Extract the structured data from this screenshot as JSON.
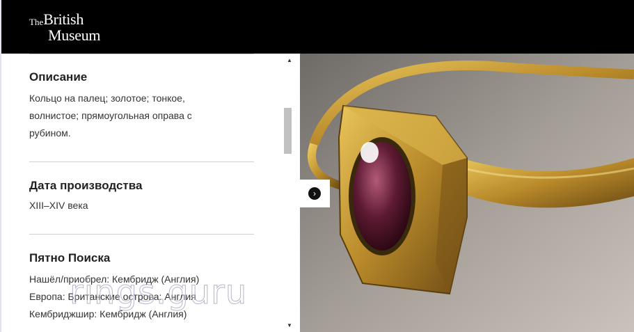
{
  "header": {
    "logo_the": "The",
    "logo_british": "British",
    "logo_museum": "Museum"
  },
  "sections": [
    {
      "heading": "Описание",
      "lines": [
        "Кольцо на палец; золотое; тонкое,",
        "волнистое; прямоугольная оправа с",
        "рубином."
      ]
    },
    {
      "heading": "Дата производства",
      "lines": [
        "XIII–XIV века"
      ]
    },
    {
      "heading": "Пятно Поиска",
      "lines": [
        "Нашёл/приобрел: Кембридж (Англия)",
        "Европа: Британские острова: Англия",
        "Кембриджшир: Кембридж (Англия)"
      ]
    }
  ],
  "image": {
    "icon": "chevron-right-icon"
  },
  "watermark": "rings.guru",
  "colors": {
    "header_bg": "#000000",
    "gold": "#c9a233",
    "ruby": "#4a1324"
  }
}
